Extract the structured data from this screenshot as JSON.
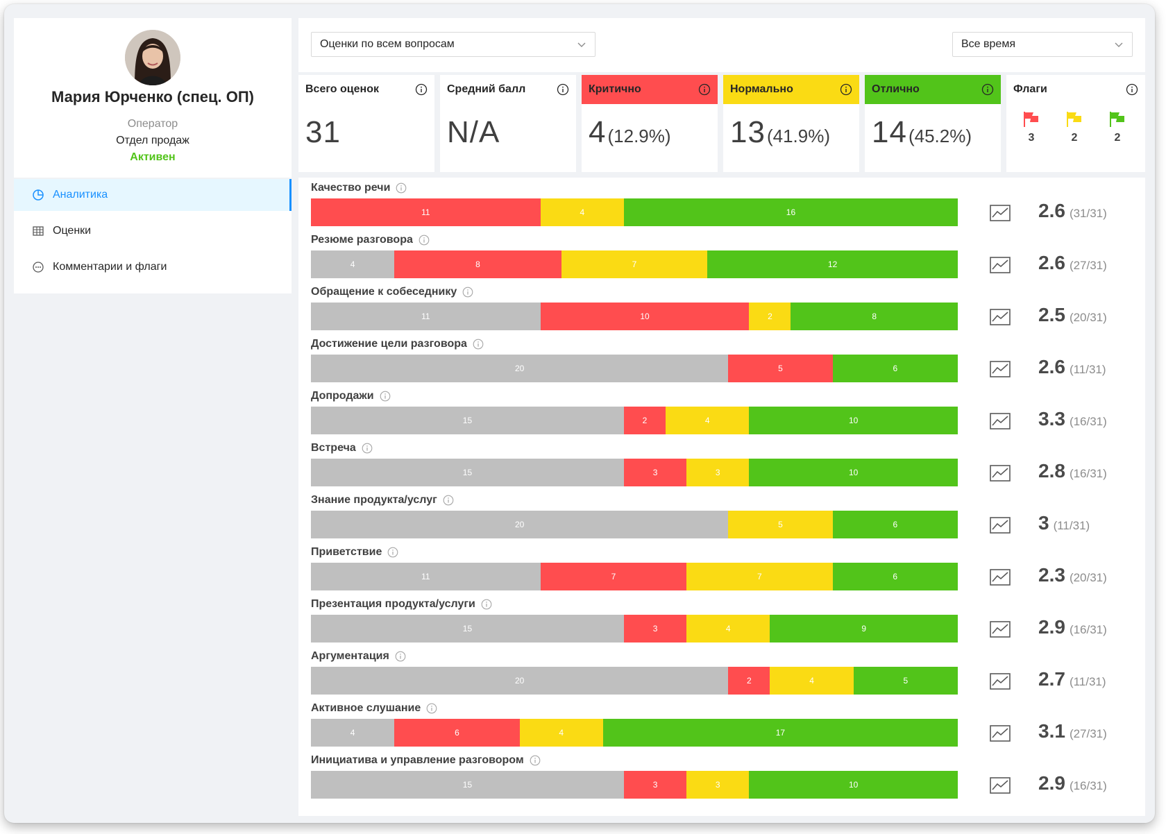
{
  "profile": {
    "name": "Мария Юрченко (спец. ОП)",
    "role": "Оператор",
    "department": "Отдел продаж",
    "status": "Активен",
    "status_color": "#52c41a"
  },
  "nav": {
    "items": [
      {
        "label": "Аналитика",
        "icon": "pie-chart-icon",
        "active": true
      },
      {
        "label": "Оценки",
        "icon": "table-icon",
        "active": false
      },
      {
        "label": "Комментарии и флаги",
        "icon": "comment-icon",
        "active": false
      }
    ]
  },
  "filters": {
    "questions": "Оценки по всем вопросам",
    "period": "Все время"
  },
  "stats": {
    "total": {
      "label": "Всего оценок",
      "value": "31"
    },
    "average": {
      "label": "Средний балл",
      "value": "N/A"
    },
    "critical": {
      "label": "Критично",
      "value": "4",
      "pct": "(12.9%)",
      "color": "#ff4d4f"
    },
    "normal": {
      "label": "Нормально",
      "value": "13",
      "pct": "(41.9%)",
      "color": "#fadb14"
    },
    "excellent": {
      "label": "Отлично",
      "value": "14",
      "pct": "(45.2%)",
      "color": "#52c41a"
    },
    "flags": {
      "label": "Флаги",
      "red": "3",
      "yellow": "2",
      "green": "2"
    }
  },
  "colors": {
    "none": "#bfbfbf",
    "critical": "#ff4d4f",
    "normal": "#fadb14",
    "excellent": "#52c41a",
    "accent": "#1890ff"
  },
  "questions": [
    {
      "label": "Качество речи",
      "none": 0,
      "critical": 11,
      "normal": 4,
      "excellent": 16,
      "score": "2.6",
      "count": "(31/31)"
    },
    {
      "label": "Резюме разговора",
      "none": 4,
      "critical": 8,
      "normal": 7,
      "excellent": 12,
      "score": "2.6",
      "count": "(27/31)"
    },
    {
      "label": "Обращение к собеседнику",
      "none": 11,
      "critical": 10,
      "normal": 2,
      "excellent": 8,
      "score": "2.5",
      "count": "(20/31)"
    },
    {
      "label": "Достижение цели разговора",
      "none": 20,
      "critical": 5,
      "normal": 0,
      "excellent": 6,
      "score": "2.6",
      "count": "(11/31)"
    },
    {
      "label": "Допродажи",
      "none": 15,
      "critical": 2,
      "normal": 4,
      "excellent": 10,
      "score": "3.3",
      "count": "(16/31)"
    },
    {
      "label": "Встреча",
      "none": 15,
      "critical": 3,
      "normal": 3,
      "excellent": 10,
      "score": "2.8",
      "count": "(16/31)"
    },
    {
      "label": "Знание продукта/услуг",
      "none": 20,
      "critical": 0,
      "normal": 5,
      "excellent": 6,
      "score": "3",
      "count": "(11/31)"
    },
    {
      "label": "Приветствие",
      "none": 11,
      "critical": 7,
      "normal": 7,
      "excellent": 6,
      "score": "2.3",
      "count": "(20/31)"
    },
    {
      "label": "Презентация продукта/услуги",
      "none": 15,
      "critical": 3,
      "normal": 4,
      "excellent": 9,
      "score": "2.9",
      "count": "(16/31)"
    },
    {
      "label": "Аргументация",
      "none": 20,
      "critical": 2,
      "normal": 4,
      "excellent": 5,
      "score": "2.7",
      "count": "(11/31)"
    },
    {
      "label": "Активное слушание",
      "none": 4,
      "critical": 6,
      "normal": 4,
      "excellent": 17,
      "score": "3.1",
      "count": "(27/31)"
    },
    {
      "label": "Инициатива и управление разговором",
      "none": 15,
      "critical": 3,
      "normal": 3,
      "excellent": 10,
      "score": "2.9",
      "count": "(16/31)"
    }
  ]
}
